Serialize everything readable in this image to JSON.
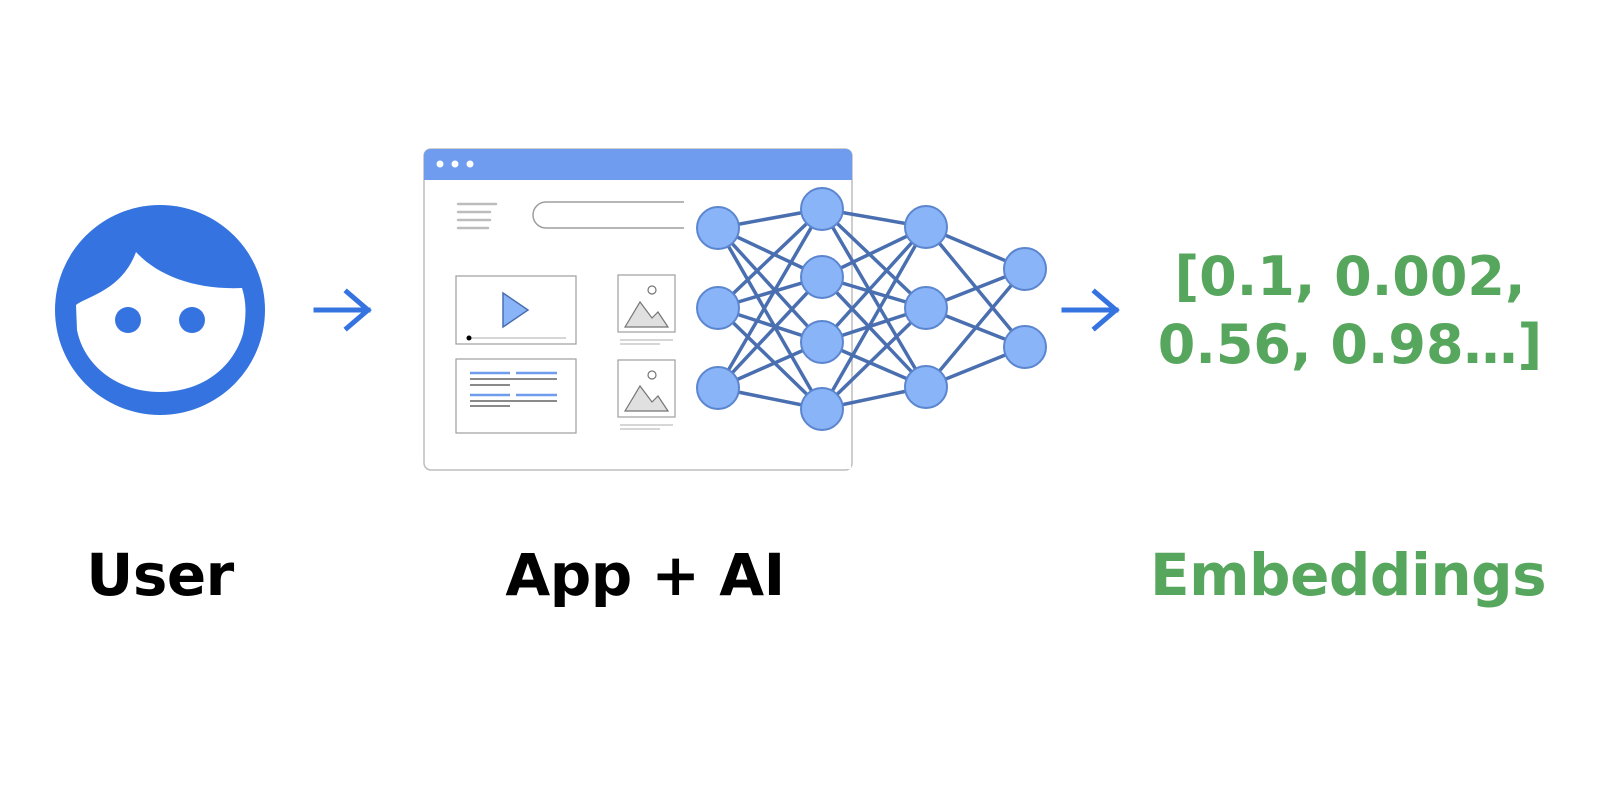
{
  "colors": {
    "blue": "#3574e0",
    "browser_header": "#6f9cee",
    "node_fill": "#8ab4f8",
    "edge": "#4a6fb0",
    "green": "#57a65e",
    "black": "#000000"
  },
  "labels": {
    "user": "User",
    "app": "App + AI",
    "embeddings": "Embeddings"
  },
  "embedding_vector": {
    "line1": "[0.1, 0.002,",
    "line2": "0.56, 0.98…]"
  },
  "icons": {
    "user": "user-face-icon",
    "arrow": "arrow-right-icon",
    "browser": "browser-window-icon",
    "network": "neural-network-icon"
  },
  "network": {
    "layer_sizes": [
      3,
      4,
      3,
      2
    ]
  }
}
